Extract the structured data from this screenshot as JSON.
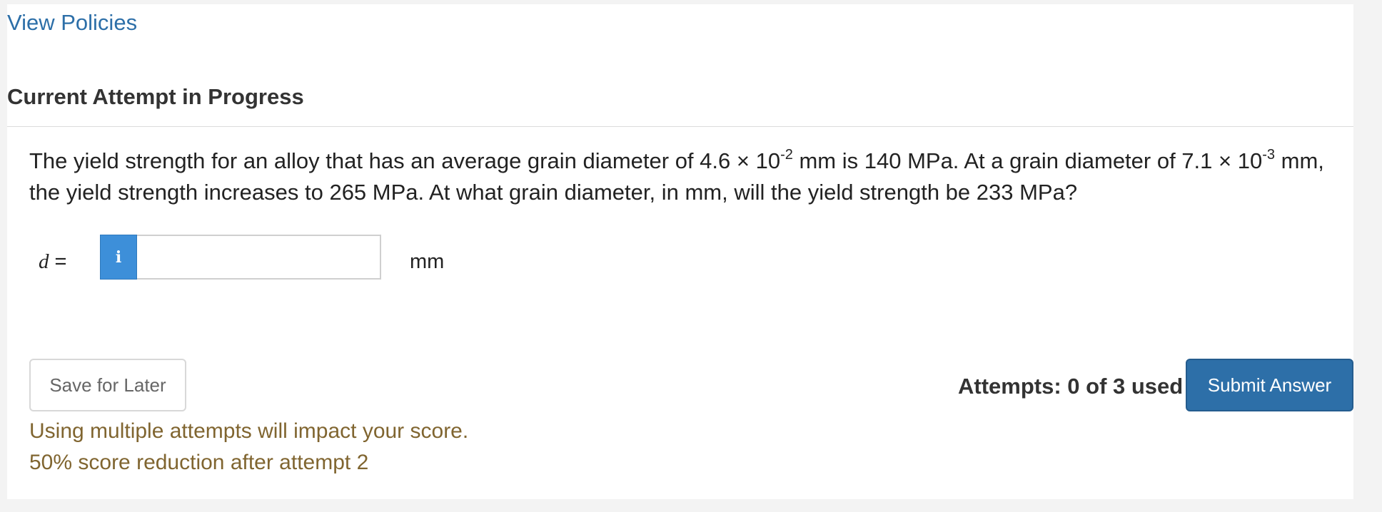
{
  "policies_link": "View Policies",
  "section_heading": "Current Attempt in Progress",
  "question": {
    "part1": "The yield strength for an alloy that has an average grain diameter of 4.6 × 10",
    "exp1": "-2",
    "part2": " mm is 140 MPa. At a grain diameter of 7.1 × 10",
    "exp2": "-3",
    "part3": " mm, the yield strength increases to 265 MPa. At what grain diameter, in mm, will the yield strength be 233 MPa?"
  },
  "answer": {
    "variable": "d",
    "equals": " =",
    "info_icon": "info-icon",
    "info_glyph": "i",
    "value": "",
    "unit": "mm"
  },
  "buttons": {
    "save_label": "Save for Later",
    "submit_label": "Submit Answer"
  },
  "attempts_text": "Attempts: 0 of 3 used",
  "warnings": [
    "Using multiple attempts will impact your score.",
    "50% score reduction after attempt 2"
  ],
  "colors": {
    "link": "#2d6fa8",
    "info_button": "#3d8fd9",
    "submit_button": "#2d6fa8",
    "warning_text": "#806530"
  }
}
